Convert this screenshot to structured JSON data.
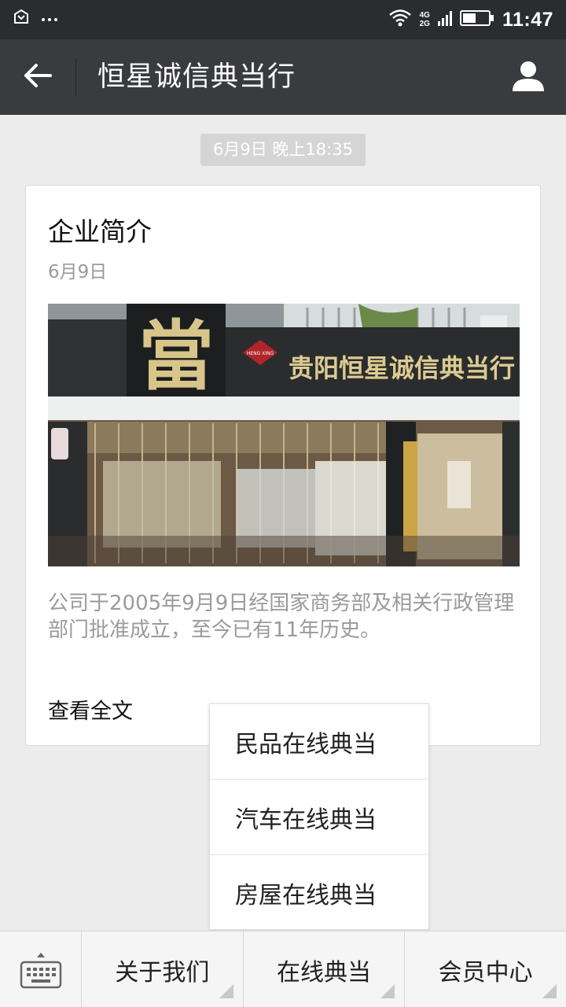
{
  "status_bar": {
    "time": "11:47",
    "network_top": "4G",
    "network_bottom": "2G",
    "icons": [
      "notification-box-icon",
      "more-dots-icon",
      "wifi-icon",
      "signal-icon",
      "battery-icon"
    ]
  },
  "header": {
    "title": "恒星诚信典当行",
    "back_icon": "back-arrow-icon",
    "profile_icon": "person-icon"
  },
  "message": {
    "timestamp": "6月9日 晚上18:35",
    "article": {
      "title": "企业简介",
      "date": "6月9日",
      "summary": "公司于2005年9月9日经国家商务部及相关行政管理部门批准成立，至今已有11年历史。",
      "read_more": "查看全文",
      "image": {
        "sign_text": "贵阳恒星诚信典当行",
        "big_char": "當",
        "badge_text": "HENG XING"
      }
    }
  },
  "popup_menu": {
    "items": [
      {
        "label": "民品在线典当"
      },
      {
        "label": "汽车在线典当"
      },
      {
        "label": "房屋在线典当"
      }
    ]
  },
  "bottom_menu": {
    "keyboard_icon": "keyboard-icon",
    "items": [
      {
        "label": "关于我们"
      },
      {
        "label": "在线典当"
      },
      {
        "label": "会员中心"
      }
    ]
  },
  "colors": {
    "status_bar": "#2b2c30",
    "title_bar": "#3a3b3f",
    "background": "#ececec",
    "card": "#ffffff",
    "muted_text": "#9a9a9a"
  }
}
